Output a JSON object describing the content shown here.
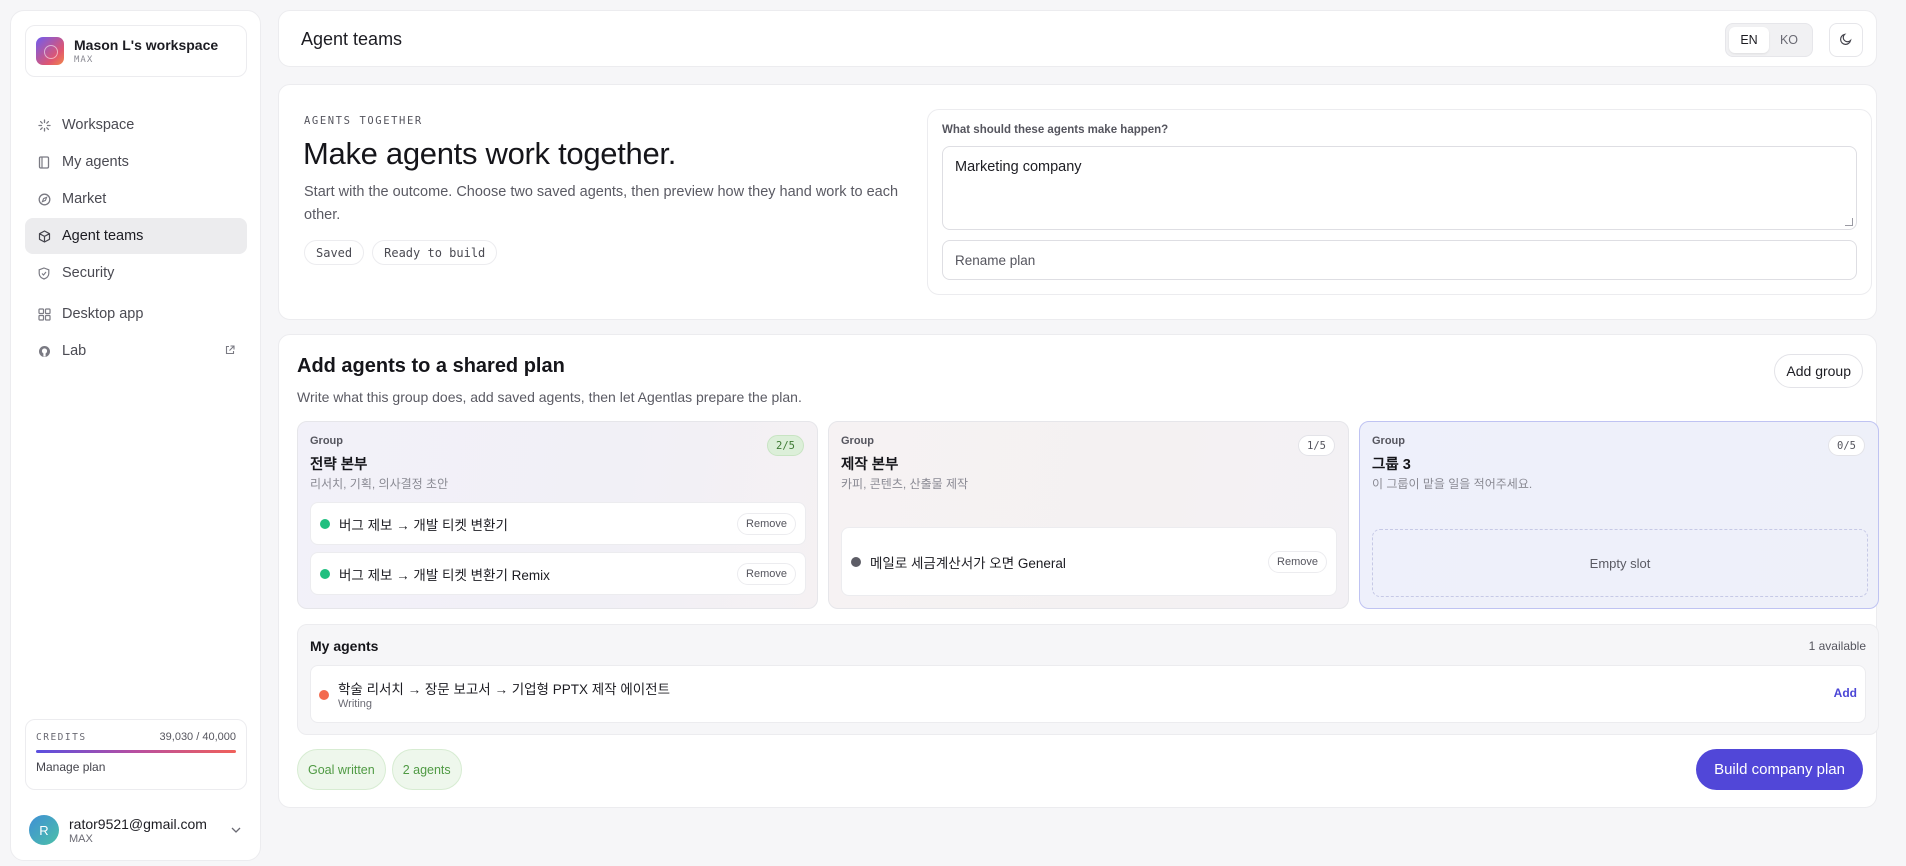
{
  "sidebar": {
    "workspace": {
      "name": "Mason L's workspace",
      "plan": "MAX"
    },
    "nav": [
      {
        "label": "Workspace",
        "icon": "sparkle-icon"
      },
      {
        "label": "My agents",
        "icon": "book-icon"
      },
      {
        "label": "Market",
        "icon": "compass-icon"
      },
      {
        "label": "Agent teams",
        "icon": "cube-icon",
        "active": true
      },
      {
        "label": "Security",
        "icon": "shield-icon"
      }
    ],
    "nav2": [
      {
        "label": "Desktop app",
        "icon": "grid-icon"
      },
      {
        "label": "Lab",
        "icon": "github-icon"
      }
    ],
    "credits": {
      "label": "CREDITS",
      "value": "39,030 / 40,000",
      "used_fraction": 0.976,
      "manage": "Manage plan"
    },
    "user": {
      "initial": "R",
      "email": "rator9521@gmail.com",
      "plan": "MAX"
    }
  },
  "topbar": {
    "title": "Agent teams",
    "lang": {
      "en": "EN",
      "ko": "KO",
      "selected": "EN"
    }
  },
  "hero": {
    "eyebrow": "AGENTS TOGETHER",
    "title": "Make agents work together.",
    "description": "Start with the outcome. Choose two saved agents, then preview how they hand work to each other.",
    "chips": [
      "Saved",
      "Ready to build"
    ],
    "goal": {
      "label": "What should these agents make happen?",
      "value": "Marketing company",
      "rename_placeholder": "Rename plan"
    }
  },
  "plan": {
    "title": "Add agents to a shared plan",
    "description": "Write what this group does, add saved agents, then let Agentlas prepare the plan.",
    "add_group": "Add group",
    "groups": [
      {
        "tag": "Group",
        "name": "전략 본부",
        "subtitle": "리서치, 기획, 의사결정 초안",
        "count": "2/5",
        "agents": [
          {
            "name": "버그 제보 → 개발 티켓 변환기",
            "status": "green",
            "remove": "Remove"
          },
          {
            "name": "버그 제보 → 개발 티켓 변환기 Remix",
            "status": "green",
            "remove": "Remove"
          }
        ]
      },
      {
        "tag": "Group",
        "name": "제작 본부",
        "subtitle": "카피, 콘텐츠, 산출물 제작",
        "count": "1/5",
        "agents": [
          {
            "name": "메일로 세금계산서가 오면 General",
            "status": "gray",
            "remove": "Remove"
          }
        ]
      },
      {
        "tag": "Group",
        "name": "그룹 3",
        "subtitle": "이 그룹이 맡을 일을 적어주세요.",
        "count": "0/5",
        "empty_slot": "Empty slot"
      }
    ],
    "my_agents": {
      "title": "My agents",
      "count": "1 available",
      "items": [
        {
          "name": "학술 리서치 → 장문 보고서 → 기업형 PPTX 제작 에이전트",
          "category": "Writing",
          "action": "Add"
        }
      ]
    },
    "status": [
      "Goal written",
      "2 agents"
    ],
    "build_button": "Build company plan"
  },
  "colors": {
    "accent": "#5147d8",
    "status_green": "#1fbf7f",
    "status_gray": "#5d5d66",
    "status_orange": "#f36a4e"
  }
}
